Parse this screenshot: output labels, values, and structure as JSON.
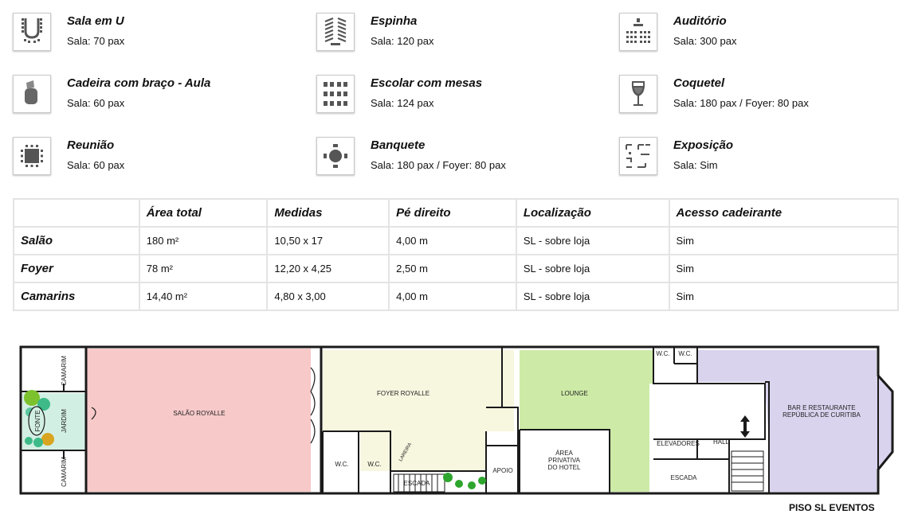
{
  "layouts": [
    {
      "title": "Sala em U",
      "capacity": "Sala: 70 pax",
      "icon": "u-shape-seating-icon"
    },
    {
      "title": "Espinha",
      "capacity": "Sala: 120 pax",
      "icon": "herringbone-seating-icon"
    },
    {
      "title": "Auditório",
      "capacity": "Sala: 300 pax",
      "icon": "auditorium-seating-icon"
    },
    {
      "title": "Cadeira com braço - Aula",
      "capacity": "Sala: 60 pax",
      "icon": "armchair-icon"
    },
    {
      "title": "Escolar com mesas",
      "capacity": "Sala: 124 pax",
      "icon": "classroom-tables-icon"
    },
    {
      "title": "Coquetel",
      "capacity": "Sala: 180 pax / Foyer: 80 pax",
      "icon": "wine-glass-icon"
    },
    {
      "title": "Reunião",
      "capacity": "Sala: 60 pax",
      "icon": "meeting-table-icon"
    },
    {
      "title": "Banquete",
      "capacity": "Sala: 180 pax / Foyer: 80 pax",
      "icon": "banquet-table-icon"
    },
    {
      "title": "Exposição",
      "capacity": "Sala: Sim",
      "icon": "exhibition-booths-icon"
    }
  ],
  "specs": {
    "headers": [
      "",
      "Área total",
      "Medidas",
      "Pé direito",
      "Localização",
      "Acesso cadeirante"
    ],
    "rows": [
      [
        "Salão",
        "180 m²",
        "10,50 x 17",
        "4,00 m",
        "SL - sobre loja",
        "Sim"
      ],
      [
        "Foyer",
        "78 m²",
        "12,20 x 4,25",
        "2,50 m",
        "SL - sobre loja",
        "Sim"
      ],
      [
        "Camarins",
        "14,40 m²",
        "4,80 x 3,00",
        "4,00 m",
        "SL - sobre loja",
        "Sim"
      ]
    ]
  },
  "floorplan": {
    "title": "PISO SL EVENTOS",
    "labels": {
      "camarim_top": "CAMARIM",
      "camarim_bottom": "CAMARIM",
      "fonte": "FONTE",
      "jardim": "JARDIM",
      "salao": "SALÃO ROYALLE",
      "foyer": "FOYER ROYALLE",
      "wc1": "W.C.",
      "wc2": "W.C.",
      "lareira": "LAREIRA",
      "escada1": "ESCADA",
      "apoio": "APOIO",
      "lounge": "LOUNGE",
      "area_privativa_1": "ÁREA",
      "area_privativa_2": "PRIVATIVA",
      "area_privativa_3": "DO HOTEL",
      "wc3": "W.C.",
      "wc4": "W.C.",
      "elevadores": "ELEVADORES",
      "hall": "HALL",
      "escada2": "ESCADA",
      "bar_1": "BAR E RESTAURANTE",
      "bar_2": "REPÚBLICA DE CURITIBA"
    },
    "colors": {
      "salao": "#f7c9c9",
      "foyer": "#f7f6df",
      "lounge": "#cdeaa6",
      "bar": "#d9d3ee",
      "jardim": "#d2efe3",
      "walls": "#1a1a1a"
    }
  }
}
